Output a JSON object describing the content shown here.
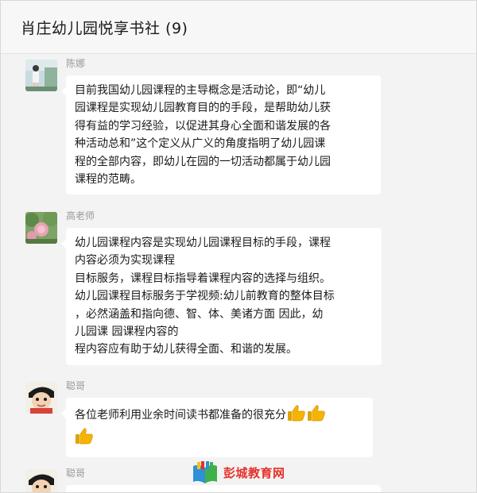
{
  "chat": {
    "title": "肖庄幼儿园悦享书社 (9)"
  },
  "messages": [
    {
      "sender": "陈娜",
      "lines": [
        "目前我国幼儿园课程的主导概念是活动论，即“幼儿",
        "园课程是实现幼儿园教育目的的手段，是帮助幼儿获",
        "得有益的学习经验，以促进其身心全面和谐发展的各",
        "种活动总和”这个定义从广义的角度指明了幼儿园课",
        "程的全部内容，即幼儿在园的一切活动都属于幼儿园",
        "课程的范畴。"
      ]
    },
    {
      "sender": "高老师",
      "lines": [
        "幼儿园课程内容是实现幼儿园课程目标的手段，课程",
        "内容必须为实现课程",
        "目标服务，课程目标指导着课程内容的选择与组织。",
        "幼儿园课程目标服务于学视频:幼儿前教育的整体目标",
        "，必然涵盖和指向德、智、体、美诸方面 因此，幼",
        "儿园课 园课程内容的",
        "程内容应有助于幼儿获得全面、和谐的发展。"
      ]
    },
    {
      "sender": "聪哥",
      "lines": [
        "各位老师利用业余时间读书都准备的很充分"
      ],
      "emoji": "thumbs-up-icon",
      "emoji_count": 3
    },
    {
      "sender": "聪哥",
      "lines": []
    }
  ],
  "watermark": {
    "text": "彭城教育网"
  },
  "colors": {
    "chat_background": "#f3f3f3",
    "bubble": "#ffffff",
    "sender_name": "#9a9a9a",
    "watermark_red": "#e7302a",
    "thumb_yellow": "#f5b400"
  }
}
